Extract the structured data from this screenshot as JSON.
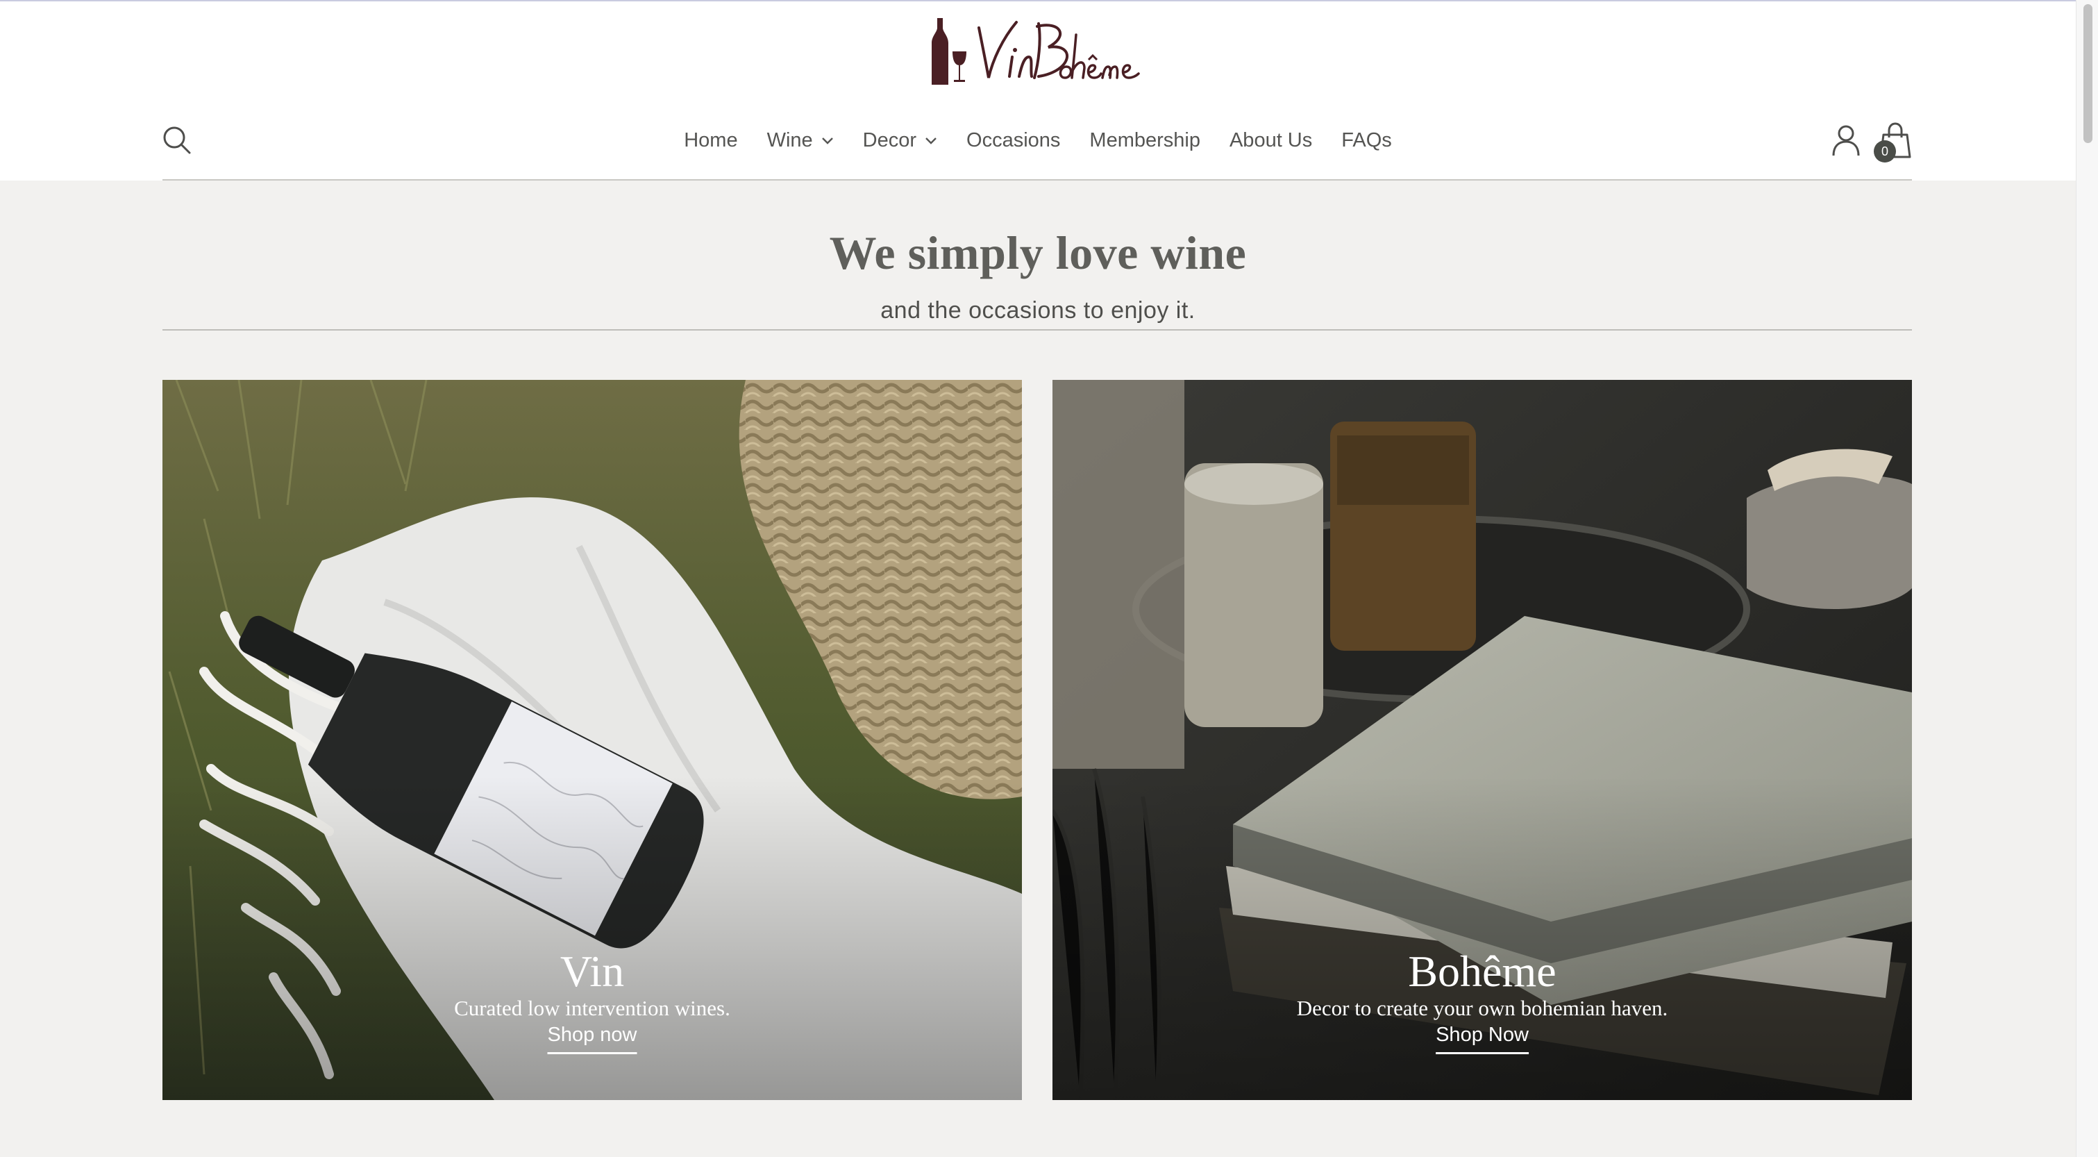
{
  "brand": {
    "logo_text": "VinBohême"
  },
  "header": {
    "search_icon": "search-icon",
    "account_icon": "user-icon",
    "cart_icon": "shopping-bag-icon",
    "cart_count": "0"
  },
  "nav": {
    "items": [
      {
        "label": "Home",
        "has_dropdown": false
      },
      {
        "label": "Wine",
        "has_dropdown": true
      },
      {
        "label": "Decor",
        "has_dropdown": true
      },
      {
        "label": "Occasions",
        "has_dropdown": false
      },
      {
        "label": "Membership",
        "has_dropdown": false
      },
      {
        "label": "About Us",
        "has_dropdown": false
      },
      {
        "label": "FAQs",
        "has_dropdown": false
      }
    ]
  },
  "hero": {
    "heading": "We simply love wine",
    "subheading": "and the occasions to enjoy it."
  },
  "cards": [
    {
      "title": "Vin",
      "subtitle": "Curated low intervention wines.",
      "link_label": "Shop now"
    },
    {
      "title": "Bohême",
      "subtitle": "Decor to create your own bohemian haven.",
      "link_label": "Shop Now"
    }
  ],
  "colors": {
    "page_bg": "#f2f1ef",
    "header_bg": "#ffffff",
    "text": "#4a4a48",
    "logo": "#4a1f24",
    "badge": "#4a4d48"
  }
}
